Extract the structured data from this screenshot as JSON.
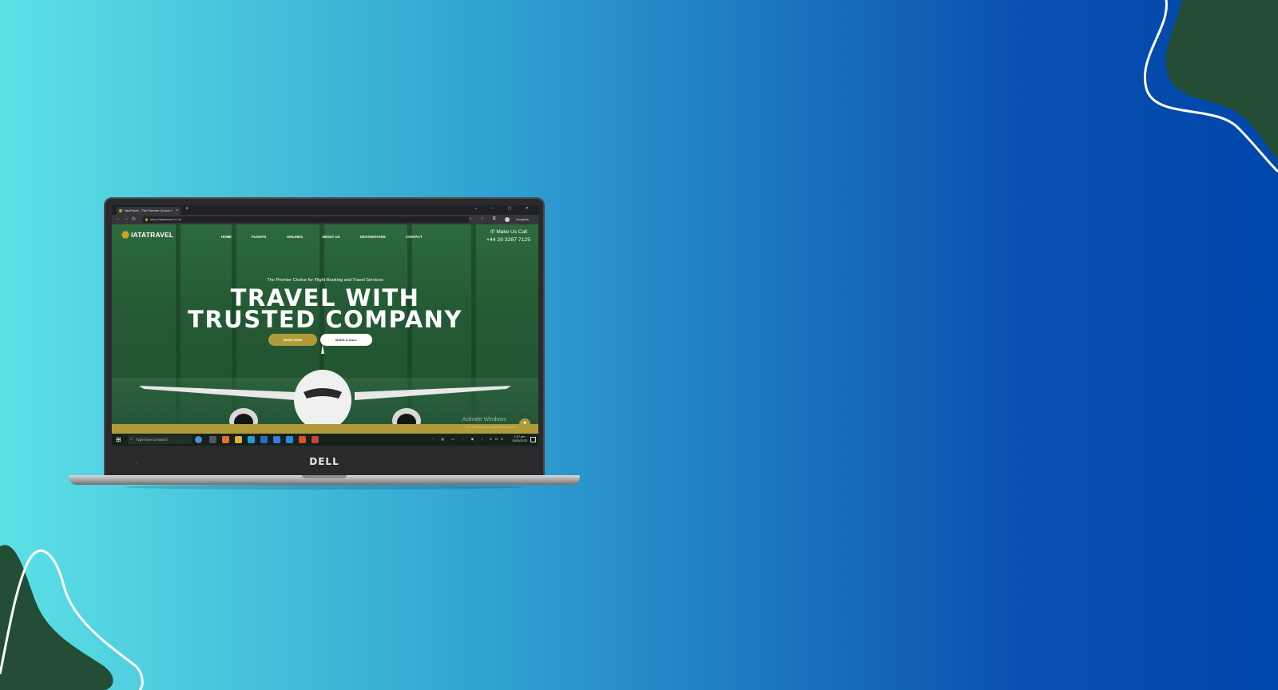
{
  "browser": {
    "tab_title": "IataTravel - The Premier Choice f",
    "tab_close": "×",
    "new_tab": "+",
    "window_controls": "⌄ – ▢ ✕",
    "nav_back": "←",
    "nav_forward": "→",
    "nav_reload": "↻",
    "url": "https://iatatravel.co.uk",
    "lock_icon": "🔒",
    "address_icons": "⌕ ☆ ◧",
    "profile_label": "Incognito"
  },
  "site": {
    "logo_text": "IATATRAVEL",
    "nav": [
      "HOME",
      "FLIGHTS",
      "AIRLINES",
      "ABOUT US",
      "DESTINATIONS",
      "CONTACT"
    ],
    "call_label": "✆ Make Us Call",
    "call_number": "+44 20 3287 7125",
    "kicker": "The Premier Choice for Flight Booking and Travel Services",
    "headline_line1": "TRAVEL WITH",
    "headline_line2": "TRUSTED COMPANY",
    "book_button": "BOOK NOW",
    "call_button": "MAKE A CALL",
    "fab_icon": "✦"
  },
  "windows": {
    "activate_title": "Activate Windows",
    "activate_sub": "Go to Settings to activate Windows.",
    "start_icon": "⊞",
    "search_icon": "⌕",
    "search_placeholder": "Type here to search",
    "tray_icons": "^ ▤ ▭ ◔ ◉ ♪ ENG",
    "time": "1:57 pm",
    "date": "15/05/2023"
  },
  "device": {
    "brand": "DELL"
  },
  "colors": {
    "site_green": "#245a34",
    "gold": "#b19a3a",
    "blob_green": "#234e35"
  }
}
